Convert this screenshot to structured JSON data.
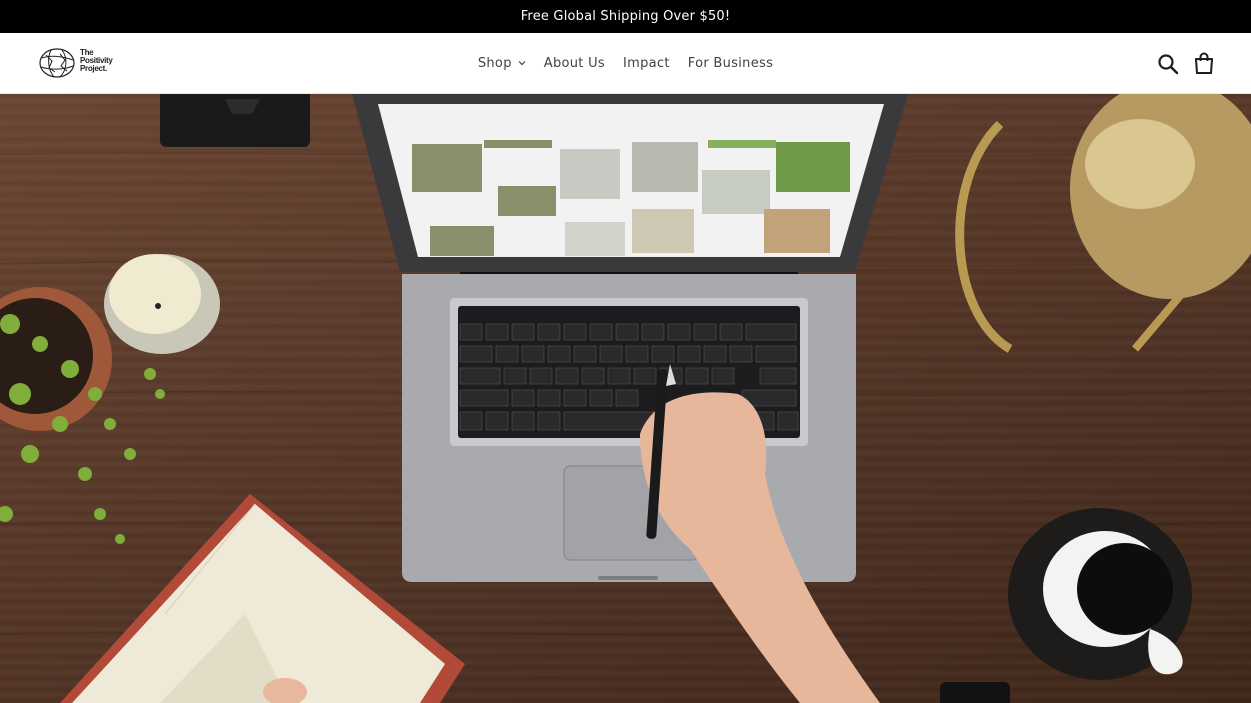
{
  "announcement": {
    "text": "Free Global Shipping Over $50!"
  },
  "header": {
    "logo_alt": "The Positivity Project.",
    "logo_lines": [
      "The",
      "Positivity",
      "Project."
    ],
    "nav": [
      {
        "label": "Shop",
        "has_dropdown": true
      },
      {
        "label": "About Us"
      },
      {
        "label": "Impact"
      },
      {
        "label": "For Business"
      }
    ],
    "icons": {
      "search": "search-icon",
      "cart": "cart-icon"
    }
  },
  "hero": {
    "image_subject": "desk-with-laptop-notebook-coffee"
  },
  "colors": {
    "announcement_bg": "#000000",
    "header_bg": "#ffffff",
    "nav_text": "#3d4246"
  }
}
